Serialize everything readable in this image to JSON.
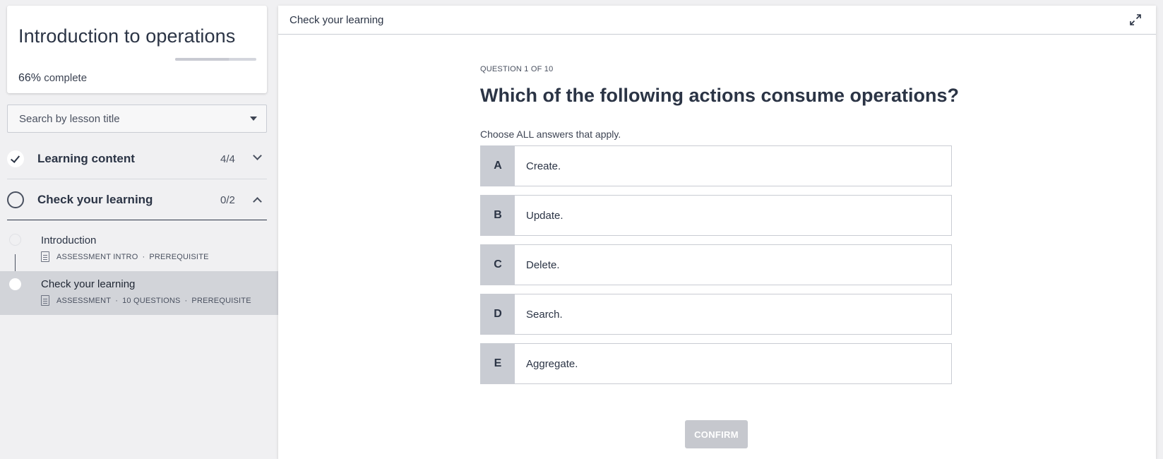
{
  "sidebar": {
    "course_title": "Introduction to operations",
    "progress_percent": 66,
    "progress_pct_text": "66%",
    "progress_complete_text": "complete",
    "search_placeholder": "Search by lesson title",
    "sections": [
      {
        "label": "Learning content",
        "count": "4/4",
        "status": "complete",
        "expanded": false
      },
      {
        "label": "Check your learning",
        "count": "0/2",
        "status": "incomplete",
        "expanded": true
      }
    ],
    "lessons": [
      {
        "title": "Introduction",
        "meta": [
          "ASSESSMENT INTRO",
          "·",
          "PREREQUISITE"
        ],
        "active": false
      },
      {
        "title": "Check your learning",
        "meta": [
          "ASSESSMENT",
          "·",
          "10 QUESTIONS",
          "·",
          "PREREQUISITE"
        ],
        "active": true
      }
    ]
  },
  "main": {
    "header_title": "Check your learning",
    "question_counter": "QUESTION 1 OF 10",
    "question_prefix": "Which of the following actions ",
    "question_bold": "consume operations?",
    "instruction": "Choose ALL answers that apply.",
    "options": [
      {
        "letter": "A",
        "text": "Create."
      },
      {
        "letter": "B",
        "text": "Update."
      },
      {
        "letter": "C",
        "text": "Delete."
      },
      {
        "letter": "D",
        "text": "Search."
      },
      {
        "letter": "E",
        "text": "Aggregate."
      }
    ],
    "confirm_label": "CONFIRM"
  },
  "colors": {
    "text": "#2b3445",
    "page_bg": "#f0f0f2",
    "option_letter_bg": "#c9ccd3",
    "active_lesson_bg": "#d2d4d9",
    "confirm_disabled_bg": "#c6c8ce"
  },
  "icons": [
    "check-icon",
    "circle-icon",
    "chevron-down-icon",
    "chevron-up-icon",
    "caret-down-icon",
    "document-icon",
    "expand-icon"
  ]
}
